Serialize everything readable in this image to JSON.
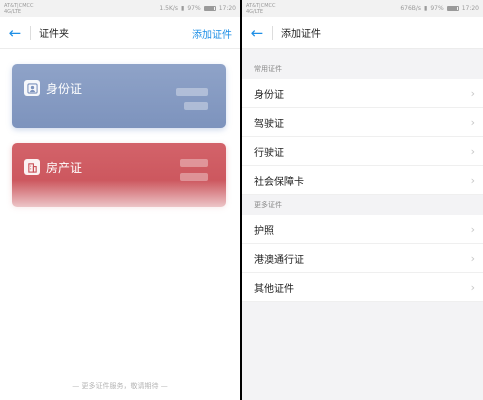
{
  "left": {
    "status": {
      "carrier": "AT&T|CMCC",
      "carrier2": "4G/LTE",
      "speed": "1.5K/s",
      "battery_percent": "97%",
      "battery_level": 0.97,
      "time": "17:20"
    },
    "title": "证件夹",
    "action": "添加证件",
    "cards": [
      {
        "name": "身份证",
        "color": "#8fa3c8"
      },
      {
        "name": "房产证",
        "color": "#d3636a"
      }
    ],
    "footer": "— 更多证件服务，敬请期待 —"
  },
  "right": {
    "status": {
      "carrier": "AT&T|CMCC",
      "carrier2": "4G/LTE",
      "speed": "676B/s",
      "battery_percent": "97%",
      "battery_level": 0.97,
      "time": "17:20"
    },
    "title": "添加证件",
    "section_common": "常用证件",
    "common": [
      {
        "label": "身份证"
      },
      {
        "label": "驾驶证"
      },
      {
        "label": "行驶证"
      },
      {
        "label": "社会保障卡"
      }
    ],
    "section_more": "更多证件",
    "more": [
      {
        "label": "护照"
      },
      {
        "label": "港澳通行证"
      },
      {
        "label": "其他证件"
      }
    ]
  },
  "accent": "#1e8fe6"
}
